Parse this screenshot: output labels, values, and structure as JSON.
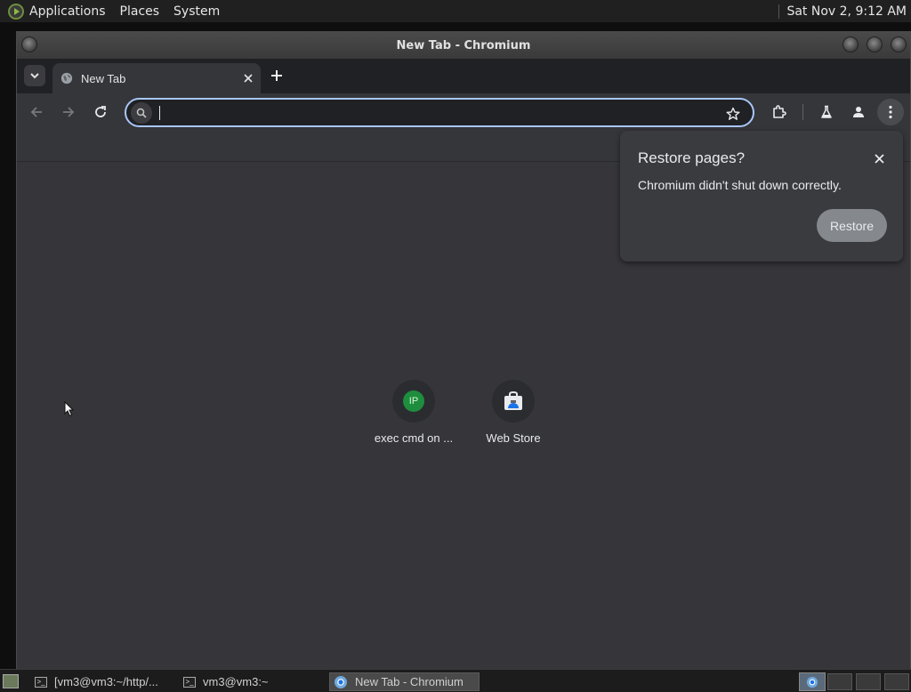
{
  "top_panel": {
    "menus": [
      "Applications",
      "Places",
      "System"
    ],
    "clock": "Sat Nov  2,  9:12 AM"
  },
  "window": {
    "title": "New Tab - Chromium"
  },
  "tabs": [
    {
      "label": "New Tab"
    }
  ],
  "omnibox": {
    "value": "",
    "placeholder": ""
  },
  "restore_bubble": {
    "heading": "Restore pages?",
    "message": "Chromium didn't shut down correctly.",
    "button": "Restore"
  },
  "shortcuts": [
    {
      "name": "exec cmd on ...",
      "icon_text": "IP"
    },
    {
      "name": "Web Store"
    }
  ],
  "taskbar": {
    "tasks": [
      {
        "label": "[vm3@vm3:~/http/..."
      },
      {
        "label": "vm3@vm3:~"
      },
      {
        "label": "New Tab - Chromium"
      }
    ]
  },
  "colors": {
    "accent_focus": "#a8c7fa",
    "content_bg": "#36363a",
    "ip_badge": "#1e8e3e"
  }
}
